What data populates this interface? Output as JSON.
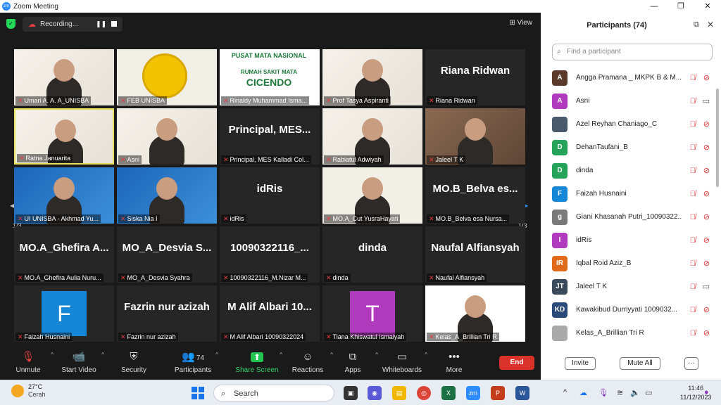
{
  "window": {
    "title": "Zoom Meeting",
    "min": "—",
    "max": "❐",
    "close": "✕"
  },
  "topbar": {
    "recording": "Recording...",
    "view": "View"
  },
  "tiles": [
    {
      "name": "Umari A. A. A_UNISBA",
      "big": "",
      "kind": "video"
    },
    {
      "name": "FEB UNISBA",
      "big": "",
      "kind": "logo"
    },
    {
      "name": "Rinaldy Muhammad Isma...",
      "big": "",
      "kind": "banner",
      "banner_title": "PUSAT MATA NASIONAL",
      "banner_sub": "RUMAH SAKIT MATA",
      "banner_big": "CICENDO"
    },
    {
      "name": "Prof Tasya Aspiranti",
      "big": "",
      "kind": "video"
    },
    {
      "name": "Riana Ridwan",
      "big": "Riana Ridwan",
      "kind": "name"
    },
    {
      "name": "Ratna Januarita",
      "big": "",
      "kind": "video",
      "active": true
    },
    {
      "name": "Asni",
      "big": "",
      "kind": "video"
    },
    {
      "name": "Principal, MES Kalladi Col...",
      "big": "Principal, MES...",
      "kind": "name"
    },
    {
      "name": "Rabiatul Adwiyah",
      "big": "",
      "kind": "video"
    },
    {
      "name": "Jaleel T K",
      "big": "",
      "kind": "video"
    },
    {
      "name": "UI UNISBA - Akhmad Yu...",
      "big": "",
      "kind": "video"
    },
    {
      "name": "Siska Nia I",
      "big": "",
      "kind": "video"
    },
    {
      "name": "idRis",
      "big": "idRis",
      "kind": "name"
    },
    {
      "name": "MO.A_Cut YusraHayati",
      "big": "",
      "kind": "video"
    },
    {
      "name": "MO.B_Belva esa Nursa...",
      "big": "MO.B_Belva es...",
      "kind": "name"
    },
    {
      "name": "MO.A_Ghefira Aulia Nuru...",
      "big": "MO.A_Ghefira A...",
      "kind": "name"
    },
    {
      "name": "MO_A_Desvia Syahra",
      "big": "MO_A_Desvia S...",
      "kind": "name"
    },
    {
      "name": "10090322116_M.Nizar M...",
      "big": "10090322116_...",
      "kind": "name"
    },
    {
      "name": "dinda",
      "big": "dinda",
      "kind": "name"
    },
    {
      "name": "Naufal Alfiansyah",
      "big": "Naufal Alfiansyah",
      "kind": "name"
    },
    {
      "name": "Faizah Husnaini",
      "big": "",
      "kind": "avatar",
      "letter": "F"
    },
    {
      "name": "Fazrin nur azizah",
      "big": "Fazrin nur azizah",
      "kind": "name"
    },
    {
      "name": "M Alif Albari 10090322024",
      "big": "M Alif Albari 10...",
      "kind": "name"
    },
    {
      "name": "Tiana Khiswatul Ismaiyah",
      "big": "",
      "kind": "avatar",
      "letter": "T"
    },
    {
      "name": "Kelas_A_Brillian Tri R",
      "big": "",
      "kind": "video"
    }
  ],
  "pager": {
    "left": "1/3",
    "right": "1/3"
  },
  "toolbar": {
    "unmute": "Unmute",
    "start_video": "Start Video",
    "security": "Security",
    "participants": "Participants",
    "participants_count": "74",
    "share": "Share Screen",
    "reactions": "Reactions",
    "apps": "Apps",
    "whiteboards": "Whiteboards",
    "more": "More",
    "end": "End"
  },
  "panel": {
    "title": "Participants (74)",
    "search_placeholder": "Find a participant",
    "invite": "Invite",
    "mute_all": "Mute All",
    "more": "···",
    "participants": [
      {
        "initial": "A",
        "name": "Angga Pramana _ MKPK B & M...",
        "color": "#5a3a2a",
        "cam_on": false
      },
      {
        "initial": "A",
        "name": "Asni",
        "color": "#b13bbd",
        "cam_on": true
      },
      {
        "initial": "",
        "name": "Azel Reyhan Chaniago_C",
        "color": "#4a5a6a",
        "cam_on": false
      },
      {
        "initial": "D",
        "name": "DehanTaufani_B",
        "color": "#26a35a",
        "cam_on": false
      },
      {
        "initial": "D",
        "name": "dinda",
        "color": "#26a35a",
        "cam_on": false
      },
      {
        "initial": "F",
        "name": "Faizah Husnaini",
        "color": "#1587d6",
        "cam_on": false
      },
      {
        "initial": "g",
        "name": "Giani Khasanah Putri_10090322...",
        "color": "#7a7a7a",
        "cam_on": false
      },
      {
        "initial": "I",
        "name": "idRis",
        "color": "#b13bbd",
        "cam_on": false
      },
      {
        "initial": "IR",
        "name": "Iqbal Roid Aziz_B",
        "color": "#e06a1a",
        "cam_on": false
      },
      {
        "initial": "JT",
        "name": "Jaleel T K",
        "color": "#3a4a5a",
        "cam_on": true
      },
      {
        "initial": "KD",
        "name": "Kawakibud Durriyyati 1009032...",
        "color": "#2a4a7a",
        "cam_on": false
      },
      {
        "initial": "",
        "name": "Kelas_A_Brillian Tri R",
        "color": "#aaaaaa",
        "cam_on": false
      }
    ]
  },
  "taskbar": {
    "temp": "27°C",
    "weather": "Cerah",
    "search": "Search",
    "time": "11:46",
    "date": "11/12/2023"
  }
}
